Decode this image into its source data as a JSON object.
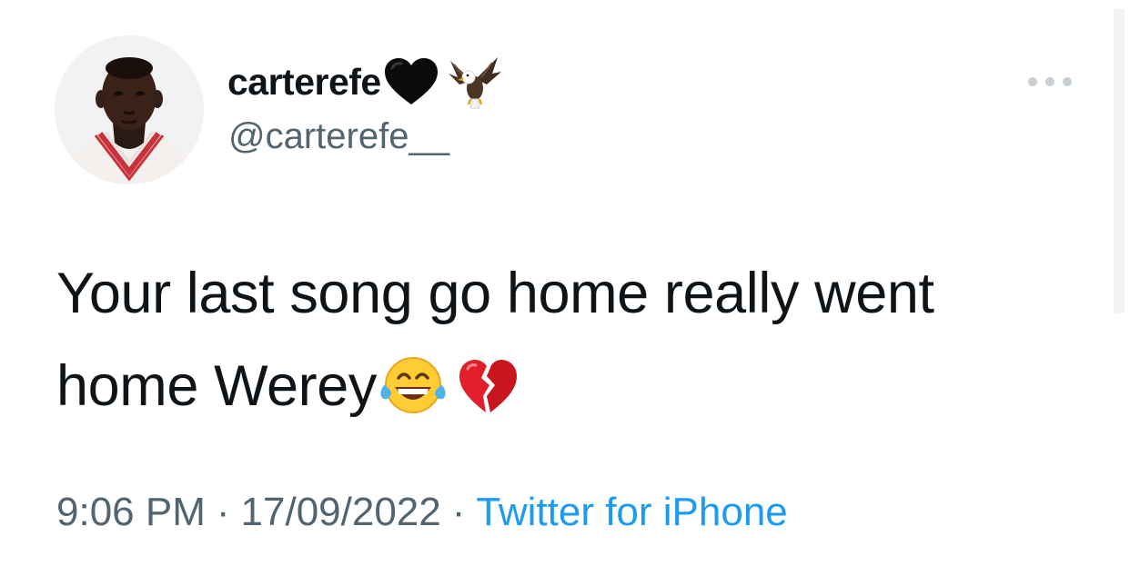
{
  "tweet": {
    "author": {
      "display_name": "carterefe",
      "handle": "@carterefe__",
      "name_emojis": [
        "black-heart-icon",
        "eagle-icon"
      ]
    },
    "text_lines": [
      "Your last song go home really went",
      "home Werey"
    ],
    "text_emojis": [
      "joy-tears-icon",
      "broken-heart-icon"
    ],
    "time": "9:06 PM",
    "date": "17/09/2022",
    "separator": "·",
    "source": "Twitter for iPhone",
    "more_icon": "more-icon"
  },
  "colors": {
    "text_primary": "#0f1419",
    "text_secondary": "#536471",
    "link": "#1d9bf0",
    "more_dots": "#c7ced4"
  }
}
